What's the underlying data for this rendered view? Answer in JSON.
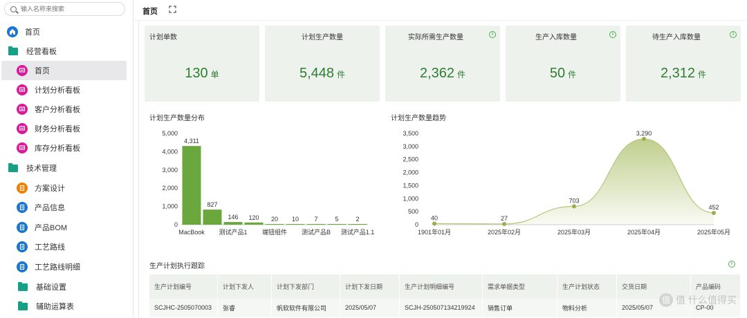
{
  "search": {
    "placeholder": "输入名称来搜索"
  },
  "sidebar": {
    "items": [
      {
        "label": "首页",
        "icon": "home-icon",
        "color": "#1976d2",
        "kind": "top"
      },
      {
        "label": "经营看板",
        "icon": "folder-icon",
        "kind": "folder"
      },
      {
        "label": "首页",
        "icon": "dashboard-icon",
        "color": "#d81b9a",
        "kind": "sub",
        "active": true
      },
      {
        "label": "计划分析看板",
        "icon": "dashboard-icon",
        "color": "#d81b9a",
        "kind": "sub"
      },
      {
        "label": "客户分析看板",
        "icon": "dashboard-icon",
        "color": "#d81b9a",
        "kind": "sub"
      },
      {
        "label": "财务分析看板",
        "icon": "dashboard-icon",
        "color": "#d81b9a",
        "kind": "sub"
      },
      {
        "label": "库存分析看板",
        "icon": "dashboard-icon",
        "color": "#d81b9a",
        "kind": "sub"
      },
      {
        "label": "技术管理",
        "icon": "folder-icon",
        "kind": "folder"
      },
      {
        "label": "方案设计",
        "icon": "document-icon",
        "color": "#f57c00",
        "kind": "sub"
      },
      {
        "label": "产品信息",
        "icon": "document-icon",
        "color": "#1976d2",
        "kind": "sub"
      },
      {
        "label": "产品BOM",
        "icon": "document-icon",
        "color": "#1976d2",
        "kind": "sub"
      },
      {
        "label": "工艺路线",
        "icon": "document-icon",
        "color": "#1976d2",
        "kind": "sub"
      },
      {
        "label": "工艺路线明细",
        "icon": "document-icon",
        "color": "#1976d2",
        "kind": "sub"
      },
      {
        "label": "基础设置",
        "icon": "folder-icon",
        "kind": "folder-sub"
      },
      {
        "label": "辅助运算表",
        "icon": "folder-icon",
        "kind": "folder-sub"
      }
    ]
  },
  "header": {
    "tab": "首页",
    "fullscreen_icon": "fullscreen-icon"
  },
  "kpis": [
    {
      "label": "计划单数",
      "value": "130",
      "unit": "单",
      "info": false
    },
    {
      "label": "计划生产数量",
      "value": "5,448",
      "unit": "件",
      "info": false
    },
    {
      "label": "实际所需生产数量",
      "value": "2,362",
      "unit": "件",
      "info": true
    },
    {
      "label": "生产入库数量",
      "value": "50",
      "unit": "件",
      "info": true
    },
    {
      "label": "待生产入库数量",
      "value": "2,312",
      "unit": "件",
      "info": true
    }
  ],
  "colors": {
    "accent": "#6aa83e",
    "kpi_bg": "#eef2ec",
    "value_green": "#2e7d32",
    "line": "#b5c77a"
  },
  "chart_data": [
    {
      "type": "bar",
      "title": "计划生产数量分布",
      "categories": [
        "MacBook",
        "",
        "测试产品1",
        "",
        "端钮组件",
        "",
        "测试产品B",
        "",
        "测试产品1.1"
      ],
      "values": [
        4311,
        827,
        146,
        120,
        20,
        10,
        7,
        5,
        2
      ],
      "value_labels": [
        "4,311",
        "827",
        "146",
        "120",
        "20",
        "10",
        "7",
        "5",
        "2"
      ],
      "yticks": [
        "5,000",
        "4,000",
        "3,000",
        "2,000",
        "1,000",
        "0"
      ],
      "ylim": [
        0,
        5000
      ],
      "color": "#6aa83e",
      "grid": false
    },
    {
      "type": "area",
      "title": "计划生产数量趋势",
      "categories": [
        "1901年01月",
        "2025年02月",
        "2025年03月",
        "2025年04月",
        "2025年05月"
      ],
      "values": [
        40,
        27,
        703,
        3290,
        452
      ],
      "value_labels": [
        "40",
        "27",
        "703",
        "3,290",
        "452"
      ],
      "yticks": [
        "3,500",
        "3,000",
        "2,500",
        "2,000",
        "1,500",
        "1,000",
        "500",
        "0"
      ],
      "ylim": [
        0,
        3500
      ],
      "color": "#b5c77a",
      "grid": false
    }
  ],
  "table": {
    "title": "生产计划执行跟踪",
    "columns": [
      "生产计划编号",
      "计划下发人",
      "计划下发部门",
      "计划下发日期",
      "生产计划明细编号",
      "需求单据类型",
      "生产计划状态",
      "交货日期",
      "产品编码"
    ],
    "rows": [
      [
        "SCJHC-2505070003",
        "张睿",
        "帆软软件有限公司",
        "2025/05/07",
        "SCJH-250507134219924",
        "销售订单",
        "物料分析",
        "2025/05/07",
        "CP-00"
      ]
    ]
  },
  "watermark": "值 什么值得买"
}
